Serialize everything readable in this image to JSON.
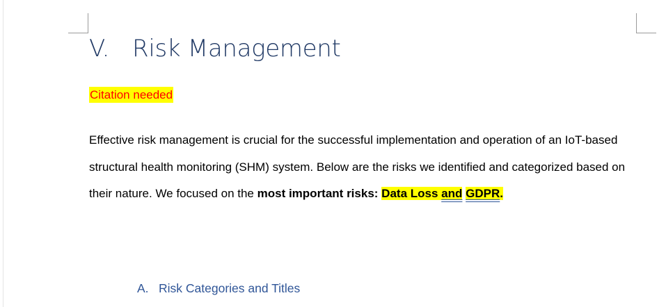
{
  "document": {
    "section_number": "V.",
    "section_title": "Risk Management",
    "citation_note": "Citation needed",
    "paragraph": {
      "text_before": "Effective risk management is crucial for the successful implementation and operation of an IoT-based structural health monitoring (SHM) system. Below are the risks we identified and categorized based on their nature. We focused on the ",
      "bold_text": "most important risks: ",
      "highlight_1": "Data Loss ",
      "highlight_2": "and",
      "highlight_3": "GDPR",
      "end_period": "."
    },
    "subsection_number": "A.",
    "subsection_title": "Risk Categories and Titles"
  },
  "colors": {
    "heading": "#1f3864",
    "subheading": "#2f5597",
    "highlight": "#ffff00",
    "citation_text": "#ff0000"
  }
}
